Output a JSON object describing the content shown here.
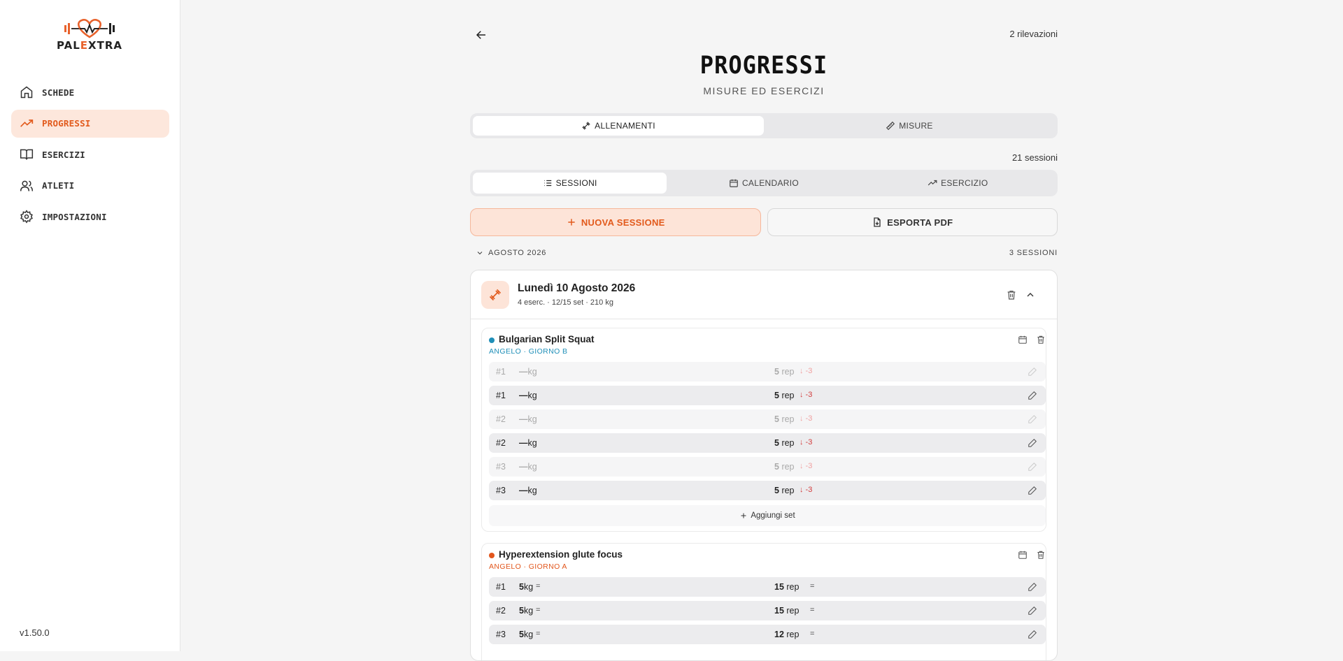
{
  "app": {
    "brand_left": "PAL",
    "brand_accent": "E",
    "brand_right": "XTRA",
    "version": "v1.50.0",
    "accent_color": "#e25a1c"
  },
  "sidebar": {
    "items": [
      {
        "label": "SCHEDE",
        "icon": "home-icon",
        "active": false
      },
      {
        "label": "PROGRESSI",
        "icon": "trending-up-icon",
        "active": true
      },
      {
        "label": "ESERCIZI",
        "icon": "book-icon",
        "active": false
      },
      {
        "label": "ATLETI",
        "icon": "users-icon",
        "active": false
      },
      {
        "label": "IMPOSTAZIONI",
        "icon": "gear-icon",
        "active": false
      }
    ]
  },
  "header": {
    "rilevazioni": "2 rilevazioni",
    "title": "PROGRESSI",
    "subtitle": "MISURE ED ESERCIZI"
  },
  "main_tabs": [
    {
      "label": "ALLENAMENTI",
      "icon": "dumbbell-icon",
      "active": true
    },
    {
      "label": "MISURE",
      "icon": "ruler-icon",
      "active": false
    }
  ],
  "sessions_count": "21 sessioni",
  "view_tabs": [
    {
      "label": "SESSIONI",
      "icon": "list-icon",
      "active": true
    },
    {
      "label": "CALENDARIO",
      "icon": "calendar-icon",
      "active": false
    },
    {
      "label": "ESERCIZIO",
      "icon": "trending-up-icon",
      "active": false
    }
  ],
  "actions": {
    "new_session": "NUOVA SESSIONE",
    "export_pdf": "ESPORTA PDF"
  },
  "month_group": {
    "label": "AGOSTO 2026",
    "count": "3 SESSIONI"
  },
  "session": {
    "date": "Lunedì 10 Agosto 2026",
    "summary": "4 eserc. · 12/15 set · 210 kg",
    "exercises": [
      {
        "name": "Bulgarian Split Squat",
        "tag": "ANGELO · GIORNO B",
        "color": "#1f8fb8",
        "sets": [
          {
            "num": "#1",
            "kg": "—",
            "kg_unit": "kg",
            "rep": "5",
            "rep_unit": "rep",
            "delta": "↓ -3",
            "ghost": true
          },
          {
            "num": "#1",
            "kg": "—",
            "kg_unit": "kg",
            "rep": "5",
            "rep_unit": "rep",
            "delta": "↓ -3",
            "ghost": false
          },
          {
            "num": "#2",
            "kg": "—",
            "kg_unit": "kg",
            "rep": "5",
            "rep_unit": "rep",
            "delta": "↓ -3",
            "ghost": true
          },
          {
            "num": "#2",
            "kg": "—",
            "kg_unit": "kg",
            "rep": "5",
            "rep_unit": "rep",
            "delta": "↓ -3",
            "ghost": false
          },
          {
            "num": "#3",
            "kg": "—",
            "kg_unit": "kg",
            "rep": "5",
            "rep_unit": "rep",
            "delta": "↓ -3",
            "ghost": true
          },
          {
            "num": "#3",
            "kg": "—",
            "kg_unit": "kg",
            "rep": "5",
            "rep_unit": "rep",
            "delta": "↓ -3",
            "ghost": false
          }
        ],
        "add_set": "Aggiungi set"
      },
      {
        "name": "Hyperextension glute focus",
        "tag": "ANGELO · GIORNO A",
        "color": "#e2561c",
        "sets": [
          {
            "num": "#1",
            "kg": "5",
            "kg_unit": "kg",
            "kg_eq": "=",
            "rep": "15",
            "rep_unit": "rep",
            "rep_eq": "=",
            "ghost": false
          },
          {
            "num": "#2",
            "kg": "5",
            "kg_unit": "kg",
            "kg_eq": "=",
            "rep": "15",
            "rep_unit": "rep",
            "rep_eq": "=",
            "ghost": false
          },
          {
            "num": "#3",
            "kg": "5",
            "kg_unit": "kg",
            "kg_eq": "=",
            "rep": "12",
            "rep_unit": "rep",
            "rep_eq": "=",
            "ghost": false
          }
        ]
      }
    ]
  }
}
